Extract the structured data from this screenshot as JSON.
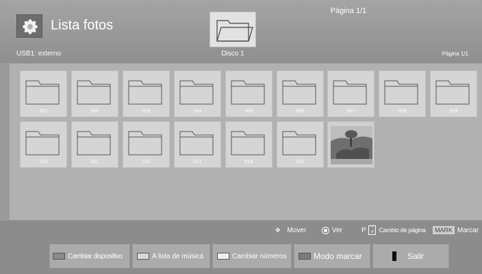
{
  "header": {
    "title": "Lista fotos",
    "page_indicator": "Página 1/1",
    "device": "USB1: externo",
    "disk": "Disco 1",
    "page_small": "Página 1/1"
  },
  "tiles": [
    {
      "label": "001",
      "type": "folder"
    },
    {
      "label": "002",
      "type": "folder"
    },
    {
      "label": "003",
      "type": "folder"
    },
    {
      "label": "004",
      "type": "folder"
    },
    {
      "label": "005",
      "type": "folder"
    },
    {
      "label": "006",
      "type": "folder"
    },
    {
      "label": "007",
      "type": "folder"
    },
    {
      "label": "008",
      "type": "folder"
    },
    {
      "label": "009",
      "type": "folder"
    },
    {
      "label": "010",
      "type": "folder"
    },
    {
      "label": "011",
      "type": "folder"
    },
    {
      "label": "012",
      "type": "folder"
    },
    {
      "label": "013",
      "type": "folder"
    },
    {
      "label": "014",
      "type": "folder"
    },
    {
      "label": "015",
      "type": "folder"
    },
    {
      "label": "",
      "type": "photo"
    }
  ],
  "legend": {
    "move": "Mover",
    "view": "Ver",
    "page_prefix": "P",
    "page_change": "Cambio de página",
    "mark_key": "MARK",
    "mark": "Marcar"
  },
  "buttons": {
    "change_device": "Cambiar dispositivo",
    "music_list": "A lista de música",
    "change_numbers": "Cambiar números",
    "mark_mode": "Modo marcar",
    "exit": "Salir"
  },
  "colors": {
    "red_key": "#8a8a8a",
    "green_key": "#d8d8d8",
    "yellow_key": "#eeeeee",
    "blue_key": "#7c7c7c"
  }
}
